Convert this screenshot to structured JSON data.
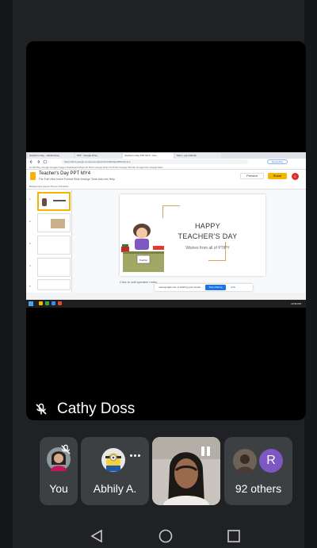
{
  "meet": {
    "main_tile": {
      "participant_name": "Cathy Doss",
      "muted": true
    },
    "participants": [
      {
        "label": "You",
        "muted": true
      },
      {
        "label": "Abhily A."
      },
      {
        "label": ""
      },
      {
        "label": "92 others",
        "avatar_letter": "R",
        "avatar_color": "#7e57c2"
      }
    ]
  },
  "shared_screen": {
    "browser_tabs": [
      "Teacher's Day - Vanilla Rose",
      "PPT - Google Drive",
      "Teacher's Day PPT MY4 - Goo",
      "Meet - pxp-bftd-fkn"
    ],
    "url": "https://docs.google.com/presentation/d/1vJ6k4q/edit#slide=id.p",
    "recording_label": "Recording",
    "bookmarks": "Gmail Play  Google  Google Images  Dashboard  Maps  All Drive  Google Drive  YouTube  Google Scholar  Google Doc  Google Meet",
    "doc_title": "Teacher's Day PPT MY4",
    "menu": "File  Edit  View  Insert  Format  Slide  Arrange  Tools  Add-ons  Help",
    "toolbar": "Background   Layout   Theme   Transition",
    "present_label": "Present",
    "share_label": "Share",
    "user_initial": "C",
    "slide_numbers": [
      "1",
      "2",
      "3",
      "4",
      "5",
      "6"
    ],
    "slide": {
      "title_line1": "HAPPY",
      "title_line2": "TEACHER'S DAY",
      "subtitle": "Wishes from all of PTIPY",
      "sign_text": "Teacher",
      "accent_color": "#d9a15b"
    },
    "notes_placeholder": "Click to add speaker notes",
    "share_banner_text": "meet.google.com is sharing your screen.",
    "stop_sharing_label": "Stop sharing",
    "hide_label": "Hide",
    "clock": "12:53 PM"
  },
  "nav": {
    "back_icon": "triangle-back-icon",
    "home_icon": "circle-home-icon",
    "recents_icon": "square-recents-icon"
  }
}
